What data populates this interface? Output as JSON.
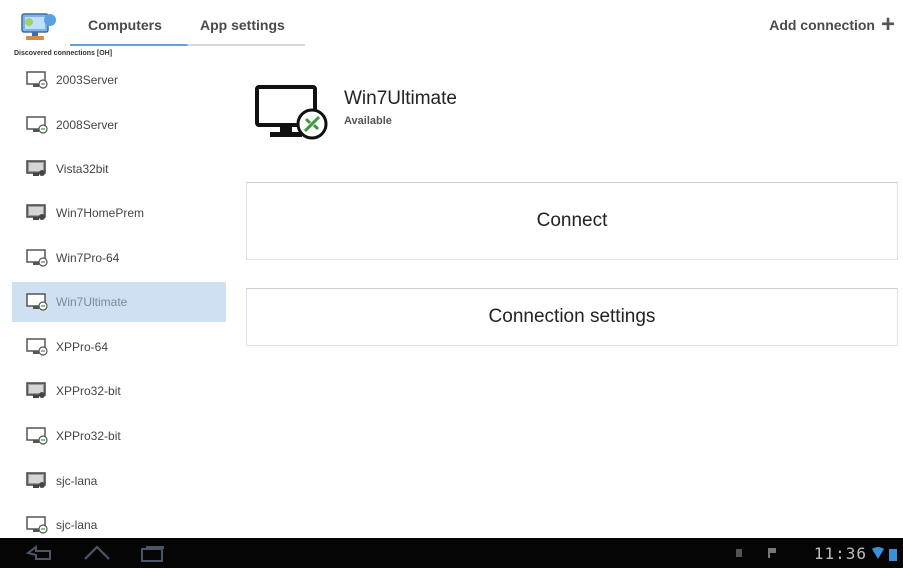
{
  "header": {
    "tabs": [
      {
        "label": "Computers",
        "selected": true
      },
      {
        "label": "App settings",
        "selected": false
      }
    ],
    "add_connection_label": "Add connection",
    "discovered_label": "Discovered connections [OH]"
  },
  "sidebar": {
    "items": [
      {
        "label": "2003Server",
        "icon": "monitor-connected-icon"
      },
      {
        "label": "2008Server",
        "icon": "monitor-connected-icon"
      },
      {
        "label": "Vista32bit",
        "icon": "monitor-screen-icon"
      },
      {
        "label": "Win7HomePrem",
        "icon": "monitor-screen-icon"
      },
      {
        "label": "Win7Pro-64",
        "icon": "monitor-connected-icon"
      },
      {
        "label": "Win7Ultimate",
        "icon": "monitor-connected-icon",
        "selected": true
      },
      {
        "label": "XPPro-64",
        "icon": "monitor-connected-icon"
      },
      {
        "label": "XPPro32-bit",
        "icon": "monitor-screen-icon"
      },
      {
        "label": "XPPro32-bit",
        "icon": "monitor-connected-icon"
      },
      {
        "label": "sjc-lana",
        "icon": "monitor-screen-icon"
      },
      {
        "label": "sjc-lana",
        "icon": "monitor-connected-icon"
      }
    ]
  },
  "detail": {
    "name": "Win7Ultimate",
    "status": "Available",
    "connect_label": "Connect",
    "settings_label": "Connection settings"
  },
  "system_bar": {
    "clock": "11:36"
  },
  "colors": {
    "selection": "#cfe0f3",
    "tab_accent": "#6aa0d6",
    "navbar": "#050505",
    "remote_green": "#3a9a3a"
  }
}
